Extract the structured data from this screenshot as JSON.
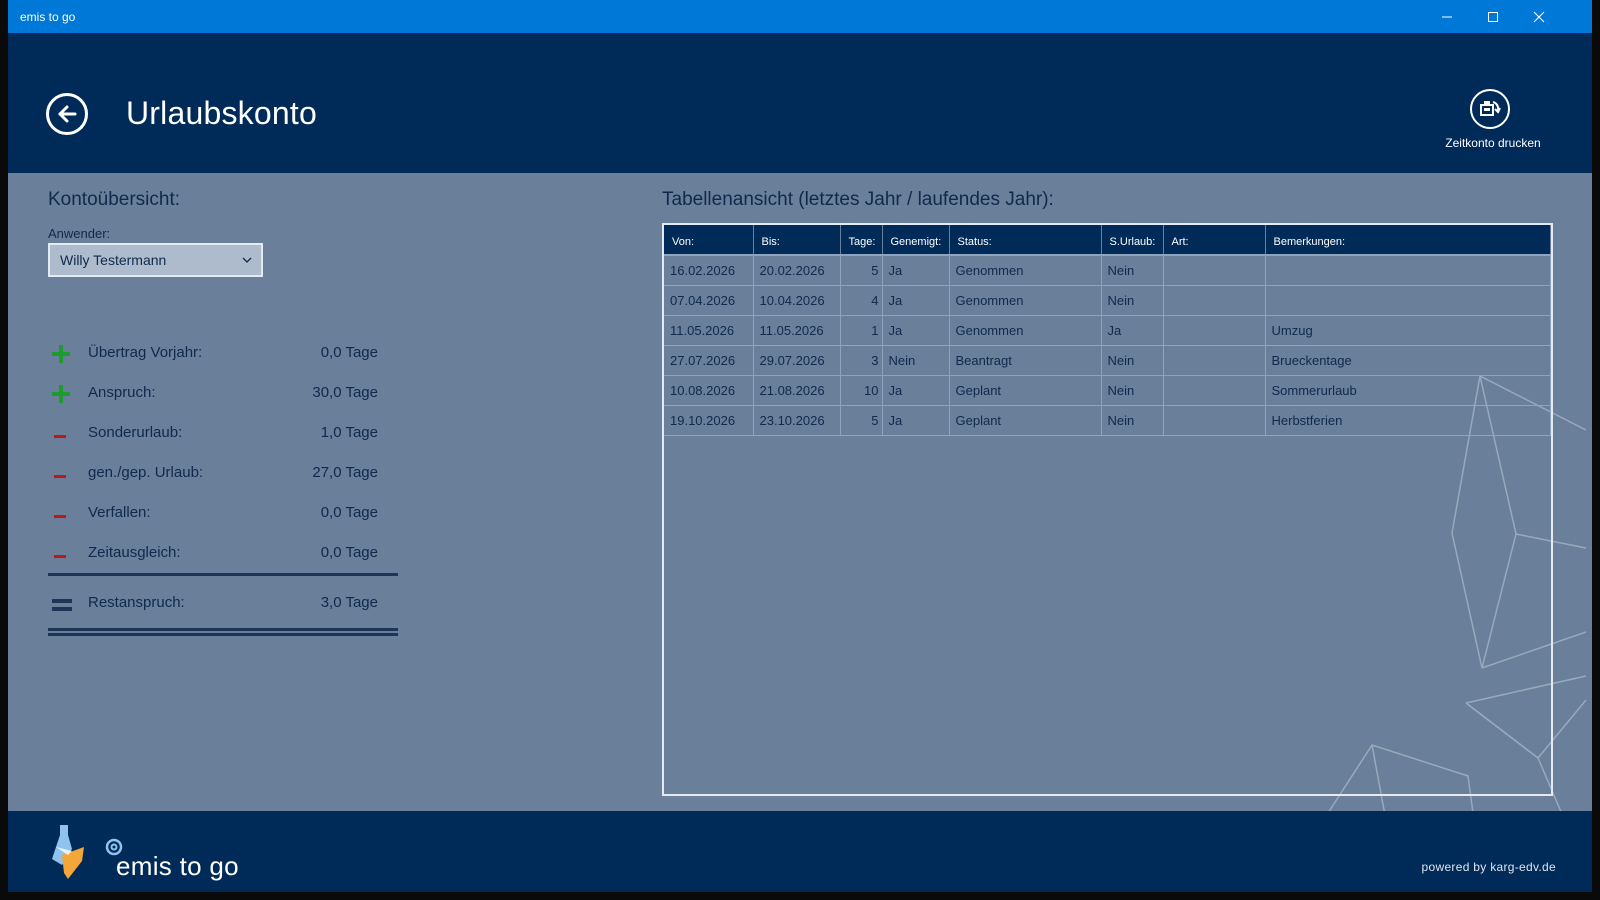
{
  "titlebar": {
    "title": "emis to go"
  },
  "header": {
    "page_title": "Urlaubskonto",
    "print_label": "Zeitkonto drucken"
  },
  "overview": {
    "title": "Kontoübersicht:",
    "user_label": "Anwender:",
    "user_value": "Willy Testermann",
    "rows": [
      {
        "sign": "plus",
        "label": "Übertrag Vorjahr:",
        "value": "0,0 Tage"
      },
      {
        "sign": "plus",
        "label": "Anspruch:",
        "value": "30,0 Tage"
      },
      {
        "sign": "minus",
        "label": "Sonderurlaub:",
        "value": "1,0 Tage"
      },
      {
        "sign": "minus",
        "label": "gen./gep. Urlaub:",
        "value": "27,0 Tage"
      },
      {
        "sign": "minus",
        "label": "Verfallen:",
        "value": "0,0 Tage"
      },
      {
        "sign": "minus",
        "label": "Zeitausgleich:",
        "value": "0,0 Tage"
      }
    ],
    "total": {
      "sign": "equals",
      "label": "Restanspruch:",
      "value": "3,0 Tage"
    }
  },
  "table": {
    "title": "Tabellenansicht (letztes Jahr / laufendes Jahr):",
    "columns": [
      "Von:",
      "Bis:",
      "Tage:",
      "Genemigt:",
      "Status:",
      "S.Urlaub:",
      "Art:",
      "Bemerkungen:"
    ],
    "rows": [
      [
        "16.02.2026",
        "20.02.2026",
        "5",
        "Ja",
        "Genommen",
        "Nein",
        "",
        ""
      ],
      [
        "07.04.2026",
        "10.04.2026",
        "4",
        "Ja",
        "Genommen",
        "Nein",
        "",
        ""
      ],
      [
        "11.05.2026",
        "11.05.2026",
        "1",
        "Ja",
        "Genommen",
        "Ja",
        "",
        "Umzug"
      ],
      [
        "27.07.2026",
        "29.07.2026",
        "3",
        "Nein",
        "Beantragt",
        "Nein",
        "",
        "Brueckentage"
      ],
      [
        "10.08.2026",
        "21.08.2026",
        "10",
        "Ja",
        "Geplant",
        "Nein",
        "",
        "Sommerurlaub"
      ],
      [
        "19.10.2026",
        "23.10.2026",
        "5",
        "Ja",
        "Geplant",
        "Nein",
        "",
        "Herbstferien"
      ]
    ]
  },
  "footer": {
    "brand": "emis to go",
    "powered": "powered by karg-edv.de"
  },
  "icons": {
    "back": "arrow-left-icon",
    "print": "print-icon",
    "dropdown": "chevron-down-icon",
    "minimize": "minimize-icon",
    "maximize": "maximize-icon",
    "close": "close-icon",
    "logo": "emis-logo-icon"
  },
  "colors": {
    "titlebar": "#0078d7",
    "header": "#002b59",
    "content": "#6a7f99",
    "plus": "#1f9a2e",
    "minus": "#c01818"
  }
}
